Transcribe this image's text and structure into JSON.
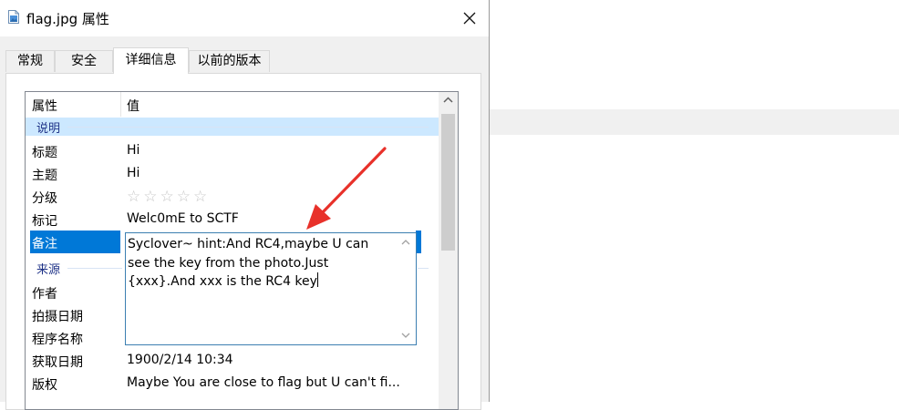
{
  "window": {
    "title": "flag.jpg 属性",
    "file_icon": "image-file-icon",
    "close_icon": "close-icon"
  },
  "tabs": [
    {
      "label": "常规",
      "active": false
    },
    {
      "label": "安全",
      "active": false
    },
    {
      "label": "详细信息",
      "active": true
    },
    {
      "label": "以前的版本",
      "active": false
    }
  ],
  "details": {
    "columns": {
      "property": "属性",
      "value": "值"
    },
    "groups": {
      "description": "说明",
      "origin": "来源"
    },
    "rows": {
      "title": {
        "name": "标题",
        "value": "Hi"
      },
      "subject": {
        "name": "主题",
        "value": "Hi"
      },
      "rating": {
        "name": "分级",
        "value": "☆☆☆☆☆",
        "stars_filled": 0,
        "stars_total": 5
      },
      "tags": {
        "name": "标记",
        "value": "Welc0mE to SCTF"
      },
      "comments": {
        "name": "备注",
        "value": "Syclover~ hint:And RC4,maybe U can see the key from the photo.Just {xxx}.And xxx is the RC4 key"
      },
      "author": {
        "name": "作者",
        "value": ""
      },
      "date_taken": {
        "name": "拍摄日期",
        "value": ""
      },
      "program_name": {
        "name": "程序名称",
        "value": ""
      },
      "date_acquired": {
        "name": "获取日期",
        "value": "1900/2/14 10:34"
      },
      "copyright": {
        "name": "版权",
        "value": "Maybe You are close to flag but U can't fi..."
      }
    }
  },
  "colors": {
    "selection": "#0078d7",
    "group_highlight": "#cce8ff",
    "annotation_arrow": "#e8312a"
  }
}
